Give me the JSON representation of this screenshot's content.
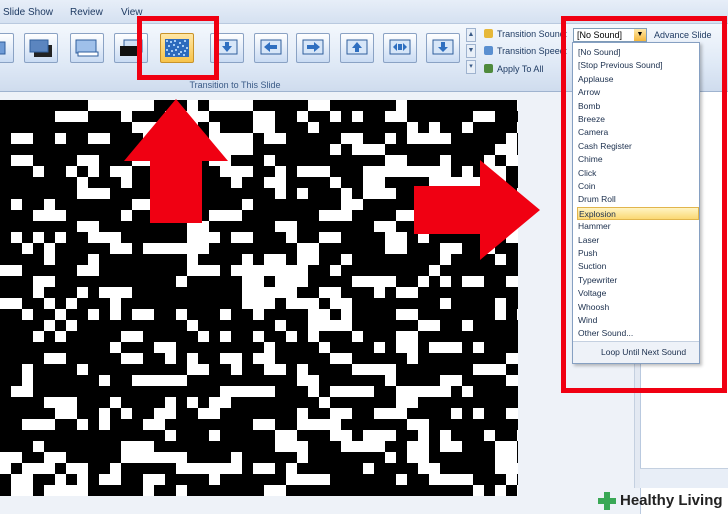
{
  "menu": {
    "tabs": [
      "Slide Show",
      "Review",
      "View"
    ]
  },
  "ribbon": {
    "group_label": "Transition to This Slide",
    "transition_sound_label": "Transition Sound:",
    "transition_speed_label": "Transition Speed:",
    "apply_to_all_label": "Apply To All",
    "sound_value": "[No Sound]",
    "advance_slide_label": "Advance Slide",
    "thumbnails": [
      {
        "name": "fade-transition-thumbnail",
        "icon": "fade-icon",
        "selected": false
      },
      {
        "name": "cut-transition-thumbnail",
        "icon": "cut-icon",
        "selected": false
      },
      {
        "name": "push-up-transition-thumbnail",
        "icon": "push-icon",
        "selected": false
      },
      {
        "name": "wipe-transition-thumbnail",
        "icon": "wipe-icon",
        "selected": false
      },
      {
        "name": "dissolve-transition-thumbnail",
        "icon": "dissolve-icon",
        "selected": true
      },
      {
        "name": "push-down-transition-thumbnail",
        "icon": "arrow-down-icon",
        "selected": false
      },
      {
        "name": "push-left-transition-thumbnail",
        "icon": "arrow-left-icon",
        "selected": false
      },
      {
        "name": "push-right-transition-thumbnail",
        "icon": "arrow-right-icon",
        "selected": false
      },
      {
        "name": "push-up-arrow-transition-thumbnail",
        "icon": "arrow-up-icon",
        "selected": false
      },
      {
        "name": "wheel-transition-thumbnail",
        "icon": "wheel-icon",
        "selected": false
      },
      {
        "name": "cover-down-transition-thumbnail",
        "icon": "arrow-down-icon",
        "selected": false
      }
    ]
  },
  "sound_dropdown": {
    "items": [
      "[No Sound]",
      "[Stop Previous Sound]",
      "Applause",
      "Arrow",
      "Bomb",
      "Breeze",
      "Camera",
      "Cash Register",
      "Chime",
      "Click",
      "Coin",
      "Drum Roll",
      "Explosion",
      "Hammer",
      "Laser",
      "Push",
      "Suction",
      "Typewriter",
      "Voltage",
      "Whoosh",
      "Wind",
      "Other Sound..."
    ],
    "selected": "Explosion",
    "loop_label": "Loop Until Next Sound"
  },
  "annotation": {
    "color": "#f00012"
  },
  "watermark": {
    "text": "Healthy Living",
    "color": "#3aa856"
  }
}
